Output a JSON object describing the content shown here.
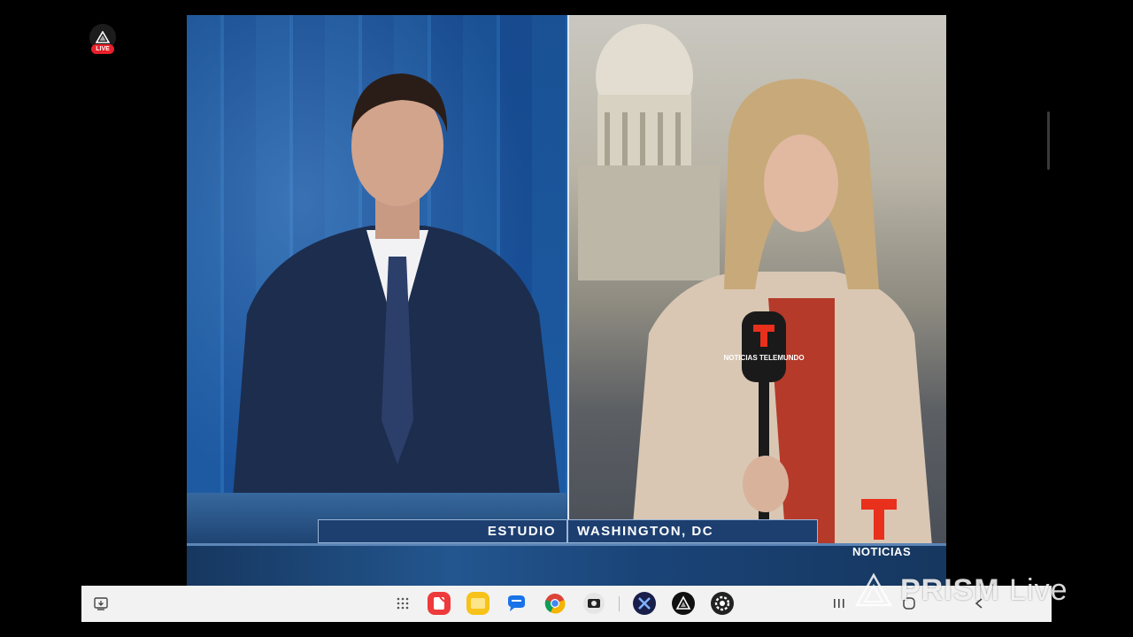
{
  "live_badge": {
    "label": "LIVE"
  },
  "video": {
    "lower_third": {
      "left": "ESTUDIO",
      "right": "WASHINGTON, DC"
    },
    "network_logo_text": "NOTICIAS",
    "mic_flag_text": "NOTICIAS TELEMUNDO"
  },
  "taskbar": {
    "apps": [
      {
        "name": "screenshot-capture"
      },
      {
        "name": "app-drawer"
      },
      {
        "name": "notes-app"
      },
      {
        "name": "memo-app"
      },
      {
        "name": "messages-app"
      },
      {
        "name": "chrome-browser"
      },
      {
        "name": "camera-app"
      },
      {
        "name": "xlive-app"
      },
      {
        "name": "prism-app"
      },
      {
        "name": "settings-app"
      }
    ],
    "nav": [
      "recents",
      "home",
      "back"
    ]
  },
  "watermark": {
    "brand": "PRISM",
    "suffix": "Live"
  },
  "colors": {
    "live_red": "#e8202a",
    "telemundo_red": "#e8301c",
    "lower_third_bg": "#1d3f70"
  }
}
